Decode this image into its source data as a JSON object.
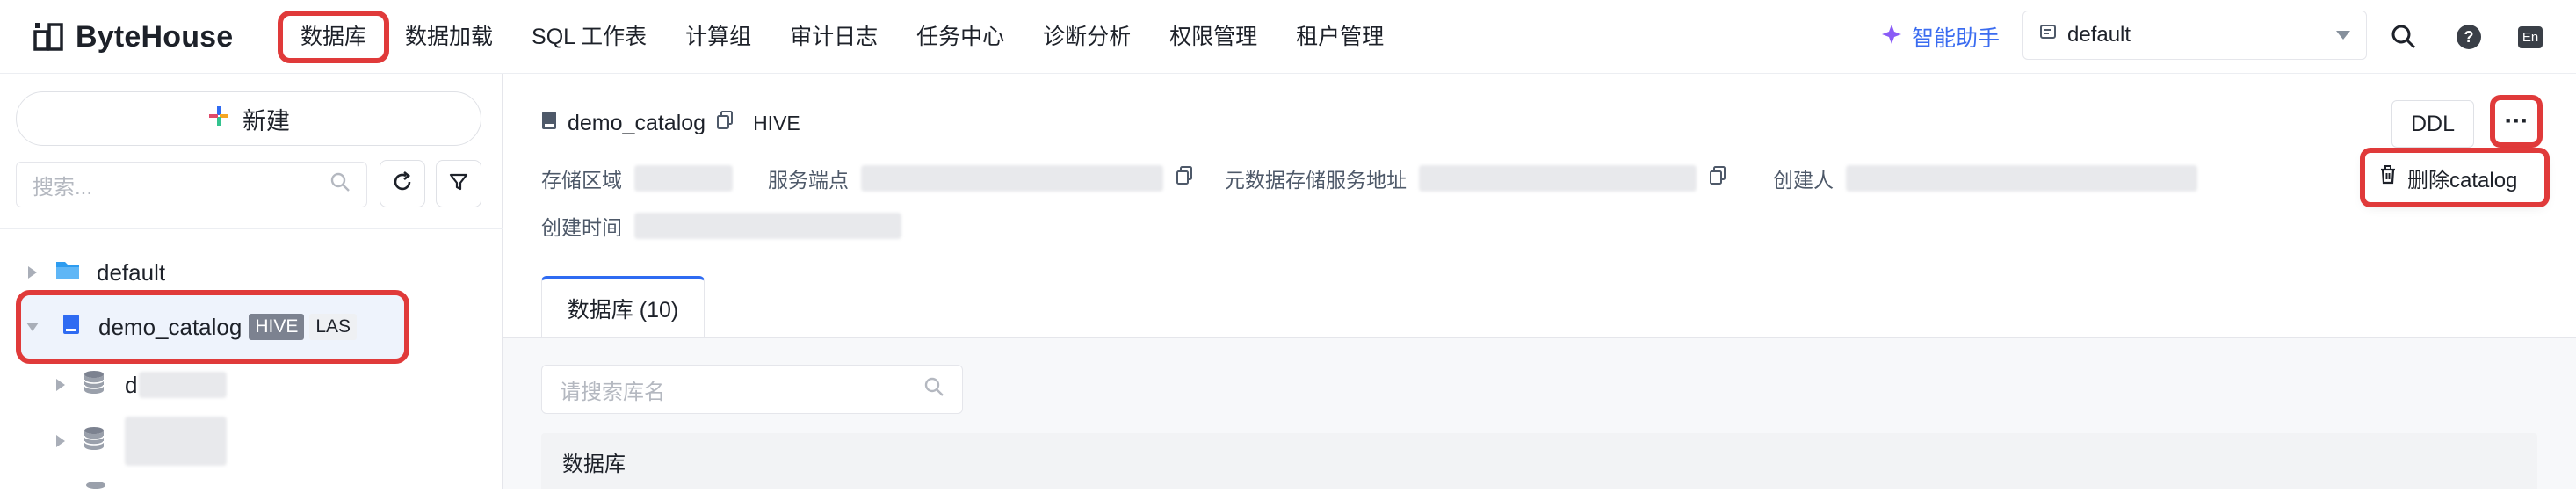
{
  "app": {
    "logo_text": "ByteHouse"
  },
  "nav": {
    "items": [
      {
        "label": "数据库",
        "active": true
      },
      {
        "label": "数据加载"
      },
      {
        "label": "SQL 工作表"
      },
      {
        "label": "计算组"
      },
      {
        "label": "审计日志"
      },
      {
        "label": "任务中心"
      },
      {
        "label": "诊断分析"
      },
      {
        "label": "权限管理"
      },
      {
        "label": "租户管理"
      }
    ],
    "assistant_label": "智能助手",
    "tenant_value": "default",
    "lang_badge": "En"
  },
  "sidebar": {
    "new_label": "新建",
    "search_placeholder": "搜索...",
    "tree": [
      {
        "label": "default"
      },
      {
        "label": "demo_catalog",
        "tag1": "HIVE",
        "tag2": "LAS"
      },
      {
        "label": "d"
      }
    ]
  },
  "detail": {
    "catalog_name": "demo_catalog",
    "catalog_type": "HIVE",
    "ddl_label": "DDL",
    "more_label": "···",
    "delete_label": "删除catalog",
    "meta": {
      "storage_region_label": "存储区域",
      "service_endpoint_label": "服务端点",
      "metastore_label": "元数据存储服务地址",
      "creator_label": "创建人",
      "created_time_label": "创建时间"
    },
    "tab_label": "数据库 (10)",
    "db_search_placeholder": "请搜索库名",
    "table_header": "数据库"
  },
  "colors": {
    "accent": "#2f6bf2",
    "highlight": "#e03a3a",
    "assistant": "#3b6cf0"
  }
}
